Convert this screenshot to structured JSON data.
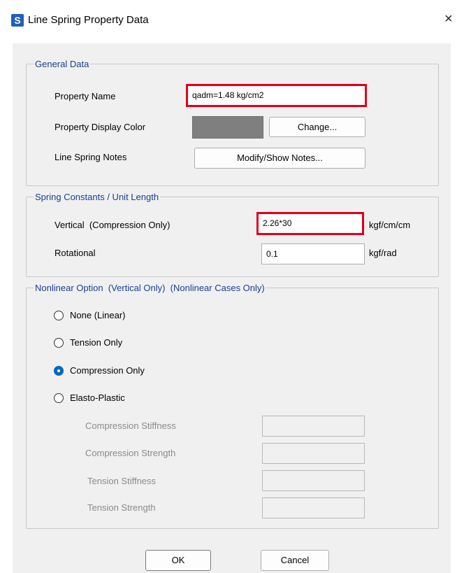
{
  "window": {
    "icon_letter": "S",
    "title": "Line Spring Property Data",
    "close_glyph": "×"
  },
  "general": {
    "legend": "General Data",
    "property_name_label": "Property Name",
    "property_name_value": "qadm=1.48 kg/cm2",
    "display_color_label": "Property Display Color",
    "display_color": "#7f7f7f",
    "change_button": "Change...",
    "notes_label": "Line Spring Notes",
    "notes_button": "Modify/Show Notes..."
  },
  "spring": {
    "legend": "Spring Constants / Unit Length",
    "vertical_label": "Vertical  (Compression Only)",
    "vertical_value": "2.26*30",
    "vertical_unit": "kgf/cm/cm",
    "rotational_label": "Rotational",
    "rotational_value": "0.1",
    "rotational_unit": "kgf/rad"
  },
  "nonlinear": {
    "legend": "Nonlinear Option  (Vertical Only)  (Nonlinear Cases Only)",
    "options": [
      {
        "label": "None (Linear)",
        "checked": false
      },
      {
        "label": "Tension Only",
        "checked": false
      },
      {
        "label": "Compression Only",
        "checked": true
      },
      {
        "label": "Elasto-Plastic",
        "checked": false
      }
    ],
    "fields": [
      {
        "label": "Compression Stiffness",
        "value": ""
      },
      {
        "label": "Compression Strength",
        "value": ""
      },
      {
        "label": "Tension Stiffness",
        "value": ""
      },
      {
        "label": "Tension Strength",
        "value": ""
      }
    ]
  },
  "footer": {
    "ok": "OK",
    "cancel": "Cancel"
  },
  "colors": {
    "highlight": "#e0001b",
    "legend": "#1a3d8f",
    "radio_checked": "#0067c0"
  }
}
